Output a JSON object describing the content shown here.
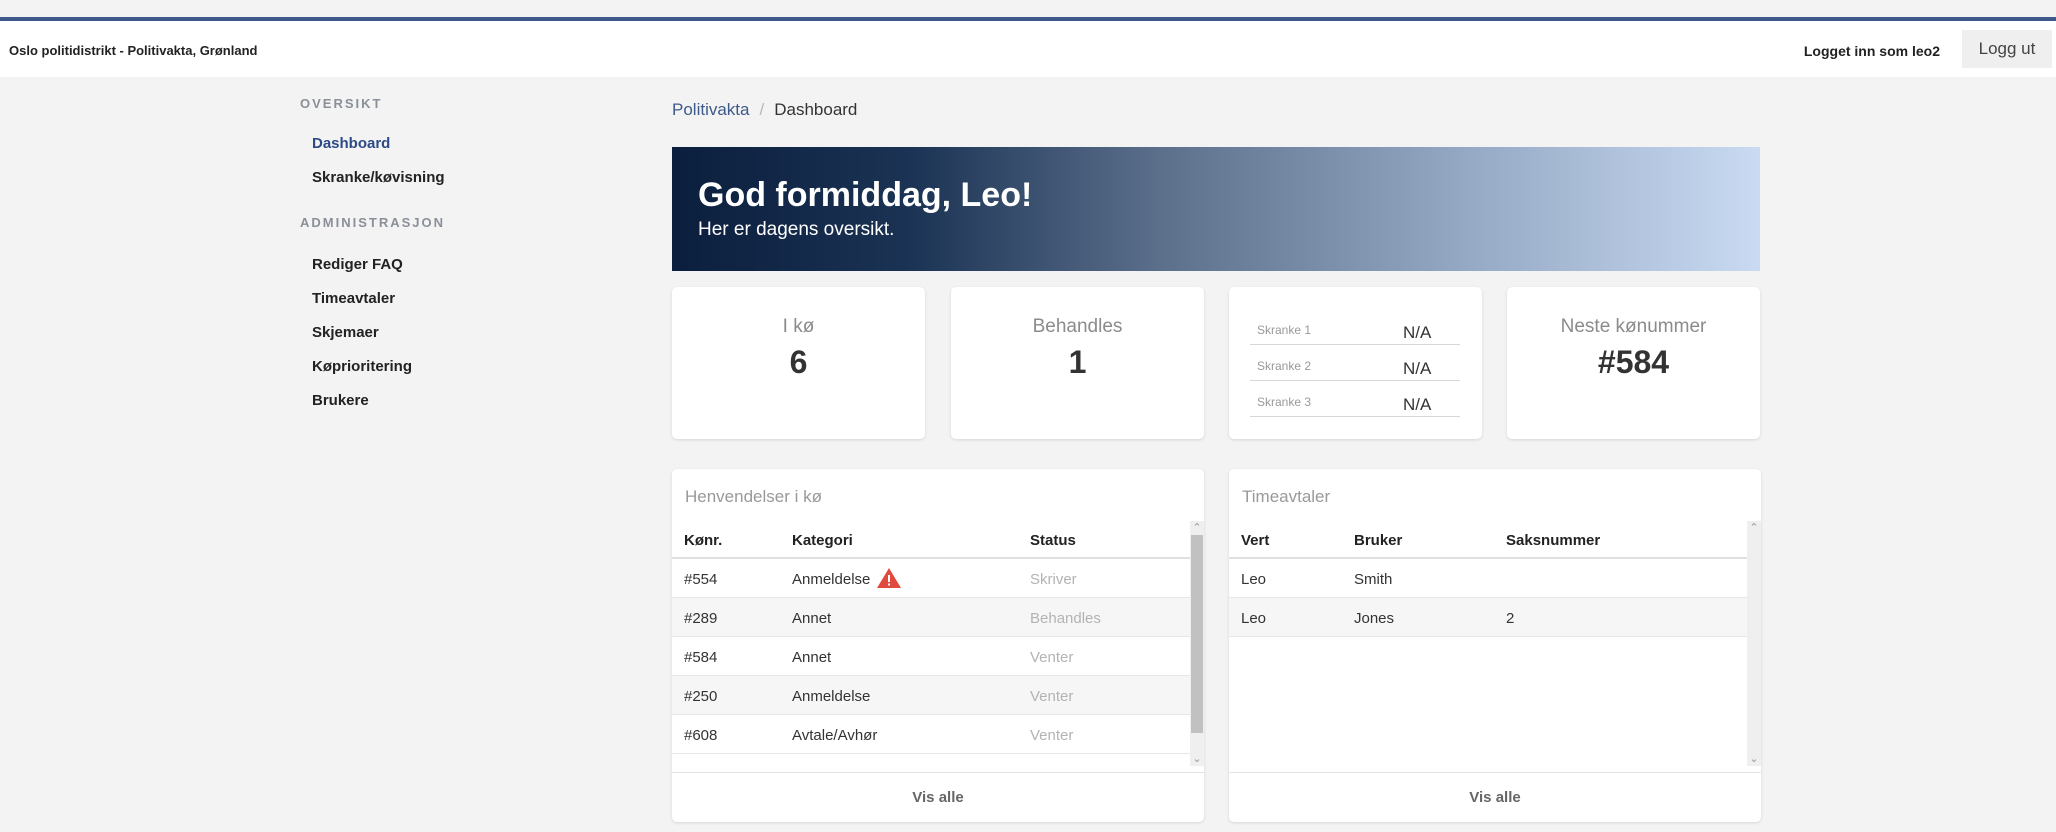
{
  "header": {
    "app_title": "Oslo politidistrikt - Politivakta, Grønland",
    "user_label": "Logget inn som leo2",
    "logout_label": "Logg ut"
  },
  "sidebar": {
    "sections": [
      {
        "title": "OVERSIKT",
        "items": [
          {
            "label": "Dashboard",
            "active": true
          },
          {
            "label": "Skranke/køvisning",
            "active": false
          }
        ]
      },
      {
        "title": "ADMINISTRASJON",
        "items": [
          {
            "label": "Rediger FAQ"
          },
          {
            "label": "Timeavtaler"
          },
          {
            "label": "Skjemaer"
          },
          {
            "label": "Køprioritering"
          },
          {
            "label": "Brukere"
          }
        ]
      }
    ]
  },
  "breadcrumb": {
    "root": "Politivakta",
    "separator": "/",
    "current": "Dashboard"
  },
  "hero": {
    "greeting": "God formiddag, Leo!",
    "subtitle": "Her er dagens oversikt."
  },
  "stats": {
    "in_queue": {
      "label": "I kø",
      "value": "6"
    },
    "processing": {
      "label": "Behandles",
      "value": "1"
    },
    "counters": [
      {
        "label": "Skranke 1",
        "value": "N/A"
      },
      {
        "label": "Skranke 2",
        "value": "N/A"
      },
      {
        "label": "Skranke 3",
        "value": "N/A"
      }
    ],
    "next_number": {
      "label": "Neste kønummer",
      "value": "#584"
    }
  },
  "queue_panel": {
    "title": "Henvendelser i kø",
    "columns": [
      "Kønr.",
      "Kategori",
      "Status"
    ],
    "rows": [
      {
        "number": "#554",
        "category": "Anmeldelse",
        "status": "Skriver",
        "warning": true
      },
      {
        "number": "#289",
        "category": "Annet",
        "status": "Behandles"
      },
      {
        "number": "#584",
        "category": "Annet",
        "status": "Venter"
      },
      {
        "number": "#250",
        "category": "Anmeldelse",
        "status": "Venter"
      },
      {
        "number": "#608",
        "category": "Avtale/Avhør",
        "status": "Venter"
      }
    ],
    "footer": "Vis alle"
  },
  "appointments_panel": {
    "title": "Timeavtaler",
    "columns": [
      "Vert",
      "Bruker",
      "Saksnummer"
    ],
    "rows": [
      {
        "host": "Leo",
        "user": "Smith",
        "case": ""
      },
      {
        "host": "Leo",
        "user": "Jones",
        "case": "2"
      }
    ],
    "footer": "Vis alle"
  },
  "colors": {
    "accent": "#3d5a8a",
    "warning": "#e04a3f"
  }
}
